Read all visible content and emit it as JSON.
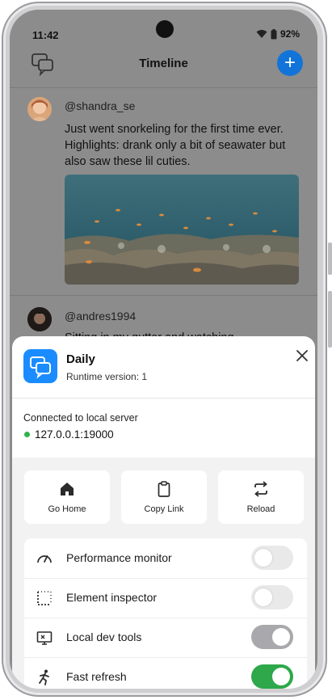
{
  "status": {
    "time": "11:42",
    "battery": "92%"
  },
  "header": {
    "title": "Timeline"
  },
  "posts": [
    {
      "handle": "@shandra_se",
      "text": "Just went snorkeling for the first time ever. Highlights: drank only a bit of seawater but also saw these lil cuties."
    },
    {
      "handle": "@andres1994",
      "text": "Sitting in my gutter and watching..."
    }
  ],
  "sheet": {
    "app_name": "Daily",
    "runtime": "Runtime version: 1",
    "connection_label": "Connected to local server",
    "connection_address": "127.0.0.1:19000",
    "actions": [
      {
        "label": "Go Home",
        "icon": "home-icon"
      },
      {
        "label": "Copy Link",
        "icon": "clipboard-icon"
      },
      {
        "label": "Reload",
        "icon": "reload-icon"
      }
    ],
    "options": [
      {
        "label": "Performance monitor",
        "icon": "gauge-icon",
        "enabled": false
      },
      {
        "label": "Element inspector",
        "icon": "inspector-icon",
        "enabled": false
      },
      {
        "label": "Local dev tools",
        "icon": "devtools-icon",
        "enabled": true
      },
      {
        "label": "Fast refresh",
        "icon": "running-icon",
        "enabled": true
      }
    ]
  },
  "colors": {
    "accent": "#1274d9",
    "app_icon": "#1a8cff",
    "connected": "#2fb34a",
    "toggle_on": "#2ea84a",
    "toggle_disabled_on": "#a9a9ad",
    "toggle_off": "#e9e9ea"
  }
}
